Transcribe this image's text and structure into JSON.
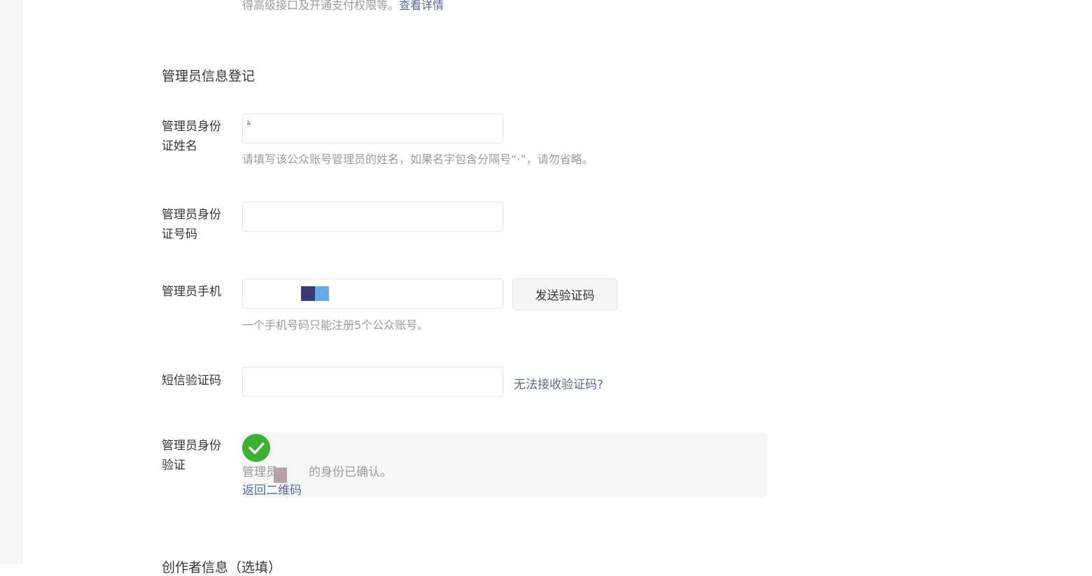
{
  "top_note": {
    "text": "得高级接口及开通支付权限等。",
    "link": "查看详情"
  },
  "section_title": "管理员信息登记",
  "form": {
    "id_name": {
      "label": "管理员身份证姓名",
      "value": "͂̀",
      "hint": "请填写该公众账号管理员的姓名，如果名字包含分隔号“·”，请勿省略。"
    },
    "id_number": {
      "label": "管理员身份证号码",
      "value": ""
    },
    "phone": {
      "label": "管理员手机",
      "value": "",
      "send_button": "发送验证码",
      "hint": "一个手机号码只能注册5个公众账号。"
    },
    "sms_code": {
      "label": "短信验证码",
      "value": "",
      "link": "无法接收验证码?"
    },
    "verify": {
      "label": "管理员身份验证",
      "status_prefix": "管理员",
      "status_suffix": "的身份已确认。",
      "back_link": "返回二维码"
    }
  },
  "next_section_title": "创作者信息（选填）",
  "colors": {
    "link": "#576b95",
    "success": "#3cb034",
    "hint": "#9a9a9a"
  }
}
